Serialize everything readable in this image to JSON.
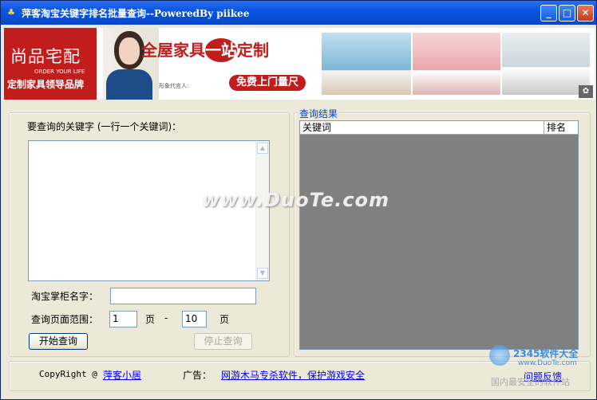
{
  "window": {
    "title": "萍客淘宝关键字排名批量查询--PoweredBy piikee",
    "minimize": "_",
    "maximize": "□",
    "close": "✕"
  },
  "banner": {
    "logo_main": "尚品宅配",
    "logo_sub": "ORDER YOUR LIFE",
    "logo_slogan": "定制家具领导品牌",
    "headline_a": "全屋家具",
    "headline_circle": "一站式",
    "headline_b": "定制",
    "rep_text": "形象代言人:",
    "button": "免费上门量尺"
  },
  "query": {
    "keywords_label": "要查询的关键字 (一行一个关键词)：",
    "keywords_value": "",
    "shop_label": "淘宝掌柜名字：",
    "shop_value": "",
    "range_label": "查询页面范围：",
    "page_from": "1",
    "page_unit_1": "页",
    "dash": "-",
    "page_to": "10",
    "page_unit_2": "页",
    "start_button": "开始查询",
    "stop_button": "停止查询"
  },
  "results": {
    "legend": "查询结果",
    "columns": [
      "关键词",
      "排名"
    ]
  },
  "footer": {
    "copyright": "CopyRight @",
    "author_link": "萍客小居",
    "ad_label": "广告：",
    "ad_link": "网游木马专杀软件，保护游戏安全",
    "feedback_link": "问题反馈"
  },
  "watermarks": {
    "duote": "www.DuoTe.com",
    "brand": "2345软件大全",
    "brand_url": "www.DuoTe.com",
    "brand_tag": "国内最安全的软件站"
  },
  "colors": {
    "titlebar": "#0a55e0",
    "window_bg": "#ece9d8",
    "results_bg": "#808080",
    "banner_red": "#c21d1d",
    "link": "#0000ff"
  }
}
